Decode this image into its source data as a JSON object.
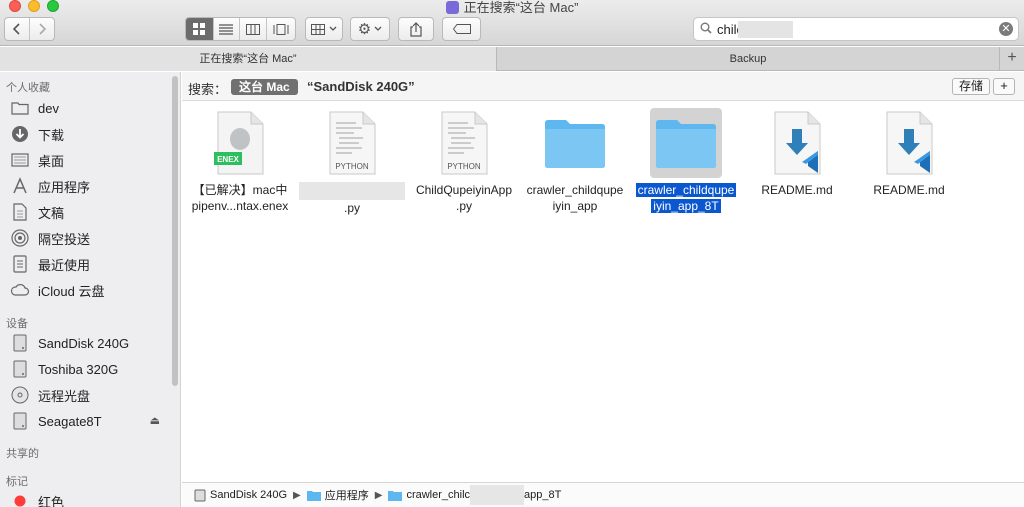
{
  "window": {
    "title": "正在搜索“这台 Mac”"
  },
  "search": {
    "query": "chilc"
  },
  "tabs": [
    {
      "label": "正在搜索“这台 Mac”"
    },
    {
      "label": "Backup"
    }
  ],
  "sidebar": {
    "favorites_header": "个人收藏",
    "favorites": [
      {
        "label": "dev",
        "icon": "folder-icon"
      },
      {
        "label": "下载",
        "icon": "download-icon"
      },
      {
        "label": "桌面",
        "icon": "desktop-icon"
      },
      {
        "label": "应用程序",
        "icon": "applications-icon"
      },
      {
        "label": "文稿",
        "icon": "document-icon"
      },
      {
        "label": "隔空投送",
        "icon": "airdrop-icon"
      },
      {
        "label": "最近使用",
        "icon": "recents-icon"
      },
      {
        "label": "iCloud 云盘",
        "icon": "cloud-icon"
      }
    ],
    "devices_header": "设备",
    "devices": [
      {
        "label": "SandDisk 240G",
        "icon": "disk-icon"
      },
      {
        "label": "Toshiba 320G",
        "icon": "disk-icon"
      },
      {
        "label": "远程光盘",
        "icon": "optical-disc-icon"
      },
      {
        "label": "Seagate8T",
        "icon": "disk-icon"
      }
    ],
    "shared_header": "共享的",
    "tags_header": "标记",
    "tags": [
      {
        "label": "红色",
        "color": "#fc3d39"
      }
    ]
  },
  "scope": {
    "label": "搜索：",
    "active": "这台 Mac",
    "other": "“SandDisk 240G”",
    "save": "存储",
    "add": "+"
  },
  "files": [
    {
      "line1": "【已解决】mac中",
      "line2": "pipenv...ntax.enex",
      "icon": "evernote-file-icon",
      "badge": "ENEX"
    },
    {
      "line1": "",
      "line2": ".py",
      "icon": "python-file-icon",
      "badge": "PYTHON"
    },
    {
      "line1": "ChildQupeiyinApp",
      "line2": ".py",
      "icon": "python-file-icon",
      "badge": "PYTHON"
    },
    {
      "line1": "crawler_childqupe",
      "line2": "iyin_app",
      "icon": "folder-icon"
    },
    {
      "line1": "crawler_childqupe",
      "line2": "iyin_app_8T",
      "icon": "folder-icon"
    },
    {
      "line1": "README.md",
      "line2": "",
      "icon": "vscode-file-icon"
    },
    {
      "line1": "README.md",
      "line2": "",
      "icon": "vscode-file-icon"
    }
  ],
  "pathbar": {
    "disk": "SandDisk 240G",
    "apps": "应用程序",
    "folder_start": "crawler_chilc",
    "folder_end": "app_8T"
  },
  "colors": {
    "accent": "#0b57d0",
    "folder": "#5fb7ef"
  }
}
